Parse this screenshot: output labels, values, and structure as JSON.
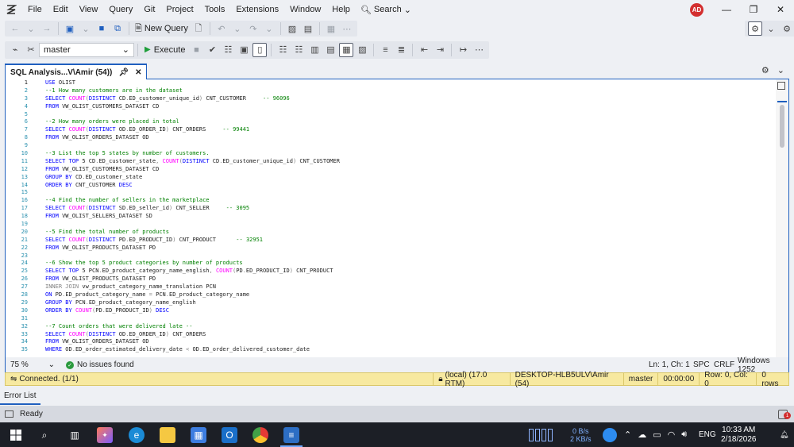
{
  "menu": {
    "items": [
      "File",
      "Edit",
      "View",
      "Query",
      "Git",
      "Project",
      "Tools",
      "Extensions",
      "Window",
      "Help"
    ],
    "search_label": "Search",
    "avatar_initials": "AD"
  },
  "toolbar1": {
    "new_query_label": "New Query"
  },
  "toolbar2": {
    "database": "master",
    "execute_label": "Execute"
  },
  "tab": {
    "title": "SQL Analysis...V\\Amir (54))"
  },
  "editor": {
    "line_numbers": [
      "1",
      "2",
      "3",
      "4",
      "5",
      "6",
      "7",
      "8",
      "9",
      "10",
      "11",
      "12",
      "13",
      "14",
      "15",
      "16",
      "17",
      "18",
      "19",
      "20",
      "21",
      "22",
      "23",
      "24",
      "25",
      "26",
      "27",
      "28",
      "29",
      "30",
      "31",
      "32",
      "33",
      "34",
      "35"
    ],
    "lines": [
      [
        {
          "t": "USE ",
          "c": "kw"
        },
        {
          "t": "OLIST",
          "c": ""
        }
      ],
      [
        {
          "t": "--1 How many customers are in the dataset",
          "c": "cm"
        }
      ],
      [
        {
          "t": "SELECT ",
          "c": "kw"
        },
        {
          "t": "COUNT",
          "c": "fn"
        },
        {
          "t": "(",
          "c": "gy"
        },
        {
          "t": "DISTINCT ",
          "c": "kw"
        },
        {
          "t": "CD",
          "c": ""
        },
        {
          "t": ".",
          "c": "gy"
        },
        {
          "t": "ED_customer_unique_id",
          "c": ""
        },
        {
          "t": ") ",
          "c": "gy"
        },
        {
          "t": "CNT_CUSTOMER     ",
          "c": ""
        },
        {
          "t": "-- 96096",
          "c": "cm"
        }
      ],
      [
        {
          "t": "FROM ",
          "c": "kw"
        },
        {
          "t": "VW_OLIST_CUSTOMERS_DATASET CD",
          "c": ""
        }
      ],
      [],
      [
        {
          "t": "--2 How many orders were placed in total",
          "c": "cm"
        }
      ],
      [
        {
          "t": "SELECT ",
          "c": "kw"
        },
        {
          "t": "COUNT",
          "c": "fn"
        },
        {
          "t": "(",
          "c": "gy"
        },
        {
          "t": "DISTINCT ",
          "c": "kw"
        },
        {
          "t": "OD",
          "c": ""
        },
        {
          "t": ".",
          "c": "gy"
        },
        {
          "t": "ED_ORDER_ID",
          "c": ""
        },
        {
          "t": ") ",
          "c": "gy"
        },
        {
          "t": "CNT_ORDERS     ",
          "c": ""
        },
        {
          "t": "-- 99441",
          "c": "cm"
        }
      ],
      [
        {
          "t": "FROM ",
          "c": "kw"
        },
        {
          "t": "VW_OLIST_ORDERS_DATASET OD",
          "c": ""
        }
      ],
      [],
      [
        {
          "t": "--3 List the top 5 states by number of customers.",
          "c": "cm"
        }
      ],
      [
        {
          "t": "SELECT TOP ",
          "c": "kw"
        },
        {
          "t": "5 CD",
          "c": ""
        },
        {
          "t": ".",
          "c": "gy"
        },
        {
          "t": "ED_customer_state",
          "c": ""
        },
        {
          "t": ", ",
          "c": "gy"
        },
        {
          "t": "COUNT",
          "c": "fn"
        },
        {
          "t": "(",
          "c": "gy"
        },
        {
          "t": "DISTINCT ",
          "c": "kw"
        },
        {
          "t": "CD",
          "c": ""
        },
        {
          "t": ".",
          "c": "gy"
        },
        {
          "t": "ED_customer_unique_id",
          "c": ""
        },
        {
          "t": ") ",
          "c": "gy"
        },
        {
          "t": "CNT_CUSTOMER",
          "c": ""
        }
      ],
      [
        {
          "t": "FROM ",
          "c": "kw"
        },
        {
          "t": "VW_OLIST_CUSTOMERS_DATASET CD",
          "c": ""
        }
      ],
      [
        {
          "t": "GROUP BY ",
          "c": "kw"
        },
        {
          "t": "CD",
          "c": ""
        },
        {
          "t": ".",
          "c": "gy"
        },
        {
          "t": "ED_customer_state",
          "c": ""
        }
      ],
      [
        {
          "t": "ORDER BY ",
          "c": "kw"
        },
        {
          "t": "CNT_CUSTOMER ",
          "c": ""
        },
        {
          "t": "DESC",
          "c": "kw"
        }
      ],
      [],
      [
        {
          "t": "--4 Find the number of sellers in the marketplace",
          "c": "cm"
        }
      ],
      [
        {
          "t": "SELECT ",
          "c": "kw"
        },
        {
          "t": "COUNT",
          "c": "fn"
        },
        {
          "t": "(",
          "c": "gy"
        },
        {
          "t": "DISTINCT ",
          "c": "kw"
        },
        {
          "t": "SD",
          "c": ""
        },
        {
          "t": ".",
          "c": "gy"
        },
        {
          "t": "ED_seller_id",
          "c": ""
        },
        {
          "t": ") ",
          "c": "gy"
        },
        {
          "t": "CNT_SELLER     ",
          "c": ""
        },
        {
          "t": "-- 3095",
          "c": "cm"
        }
      ],
      [
        {
          "t": "FROM ",
          "c": "kw"
        },
        {
          "t": "VW_OLIST_SELLERS_DATASET SD",
          "c": ""
        }
      ],
      [],
      [
        {
          "t": "--5 Find the total number of products",
          "c": "cm"
        }
      ],
      [
        {
          "t": "SELECT ",
          "c": "kw"
        },
        {
          "t": "COUNT",
          "c": "fn"
        },
        {
          "t": "(",
          "c": "gy"
        },
        {
          "t": "DISTINCT ",
          "c": "kw"
        },
        {
          "t": "PD",
          "c": ""
        },
        {
          "t": ".",
          "c": "gy"
        },
        {
          "t": "ED_PRODUCT_ID",
          "c": ""
        },
        {
          "t": ") ",
          "c": "gy"
        },
        {
          "t": "CNT_PRODUCT      ",
          "c": ""
        },
        {
          "t": "-- 32951",
          "c": "cm"
        }
      ],
      [
        {
          "t": "FROM ",
          "c": "kw"
        },
        {
          "t": "VW_OLIST_PRODUCTS_DATASET PD",
          "c": ""
        }
      ],
      [],
      [
        {
          "t": "--6 Show the top 5 product categories by number of products",
          "c": "cm"
        }
      ],
      [
        {
          "t": "SELECT TOP ",
          "c": "kw"
        },
        {
          "t": "5 PCN",
          "c": ""
        },
        {
          "t": ".",
          "c": "gy"
        },
        {
          "t": "ED_product_category_name_english",
          "c": ""
        },
        {
          "t": ", ",
          "c": "gy"
        },
        {
          "t": "COUNT",
          "c": "fn"
        },
        {
          "t": "(",
          "c": "gy"
        },
        {
          "t": "PD",
          "c": ""
        },
        {
          "t": ".",
          "c": "gy"
        },
        {
          "t": "ED_PRODUCT_ID",
          "c": ""
        },
        {
          "t": ") ",
          "c": "gy"
        },
        {
          "t": "CNT_PRODUCT",
          "c": ""
        }
      ],
      [
        {
          "t": "FROM ",
          "c": "kw"
        },
        {
          "t": "VW_OLIST_PRODUCTS_DATASET PD",
          "c": ""
        }
      ],
      [
        {
          "t": "INNER JOIN ",
          "c": "gy"
        },
        {
          "t": "vw_product_category_name_translation PCN",
          "c": ""
        }
      ],
      [
        {
          "t": "ON ",
          "c": "kw"
        },
        {
          "t": "PD",
          "c": ""
        },
        {
          "t": ".",
          "c": "gy"
        },
        {
          "t": "ED_product_category_name ",
          "c": ""
        },
        {
          "t": "= ",
          "c": "gy"
        },
        {
          "t": "PCN",
          "c": ""
        },
        {
          "t": ".",
          "c": "gy"
        },
        {
          "t": "ED_product_category_name",
          "c": ""
        }
      ],
      [
        {
          "t": "GROUP BY ",
          "c": "kw"
        },
        {
          "t": "PCN",
          "c": ""
        },
        {
          "t": ".",
          "c": "gy"
        },
        {
          "t": "ED_product_category_name_english",
          "c": ""
        }
      ],
      [
        {
          "t": "ORDER BY ",
          "c": "kw"
        },
        {
          "t": "COUNT",
          "c": "fn"
        },
        {
          "t": "(",
          "c": "gy"
        },
        {
          "t": "PD",
          "c": ""
        },
        {
          "t": ".",
          "c": "gy"
        },
        {
          "t": "ED_PRODUCT_ID",
          "c": ""
        },
        {
          "t": ") ",
          "c": "gy"
        },
        {
          "t": "DESC",
          "c": "kw"
        }
      ],
      [],
      [
        {
          "t": "--7 Count orders that were delivered late --",
          "c": "cm"
        }
      ],
      [
        {
          "t": "SELECT ",
          "c": "kw"
        },
        {
          "t": "COUNT",
          "c": "fn"
        },
        {
          "t": "(",
          "c": "gy"
        },
        {
          "t": "DISTINCT ",
          "c": "kw"
        },
        {
          "t": "OD",
          "c": ""
        },
        {
          "t": ".",
          "c": "gy"
        },
        {
          "t": "ED_ORDER_ID",
          "c": ""
        },
        {
          "t": ") ",
          "c": "gy"
        },
        {
          "t": "CNT_ORDERS",
          "c": ""
        }
      ],
      [
        {
          "t": "FROM ",
          "c": "kw"
        },
        {
          "t": "VW_OLIST_ORDERS_DATASET OD",
          "c": ""
        }
      ],
      [
        {
          "t": "WHERE ",
          "c": "kw"
        },
        {
          "t": "OD",
          "c": ""
        },
        {
          "t": ".",
          "c": "gy"
        },
        {
          "t": "ED_order_estimated_delivery_date ",
          "c": ""
        },
        {
          "t": "< ",
          "c": "gy"
        },
        {
          "t": "OD",
          "c": ""
        },
        {
          "t": ".",
          "c": "gy"
        },
        {
          "t": "ED_order_delivered_customer_date",
          "c": ""
        }
      ]
    ]
  },
  "editor_status": {
    "zoom": "75 %",
    "issues": "No issues found",
    "position": "Ln: 1, Ch: 1",
    "spacing": "SPC",
    "line_ending": "CRLF",
    "encoding": "Windows 1252"
  },
  "connection": {
    "status": "Connected. (1/1)",
    "server": "(local) (17.0 RTM)",
    "user": "DESKTOP-HLB5ULV\\Amir (54)",
    "database": "master",
    "elapsed": "00:00:00",
    "row_col": "Row: 0, Col: 0",
    "rows": "0 rows"
  },
  "error_list_label": "Error List",
  "app_status": {
    "text": "Ready"
  },
  "taskbar": {
    "net_up": "0 B/s",
    "net_down": "2 KB/s",
    "lang": "ENG",
    "time": "10:33 AM",
    "date": "2/18/2026"
  },
  "colors": {
    "accent": "#1f5fbf",
    "keyword": "#0000ff",
    "function": "#ff00ff",
    "comment": "#008000",
    "connbar": "#f7e9a0"
  }
}
